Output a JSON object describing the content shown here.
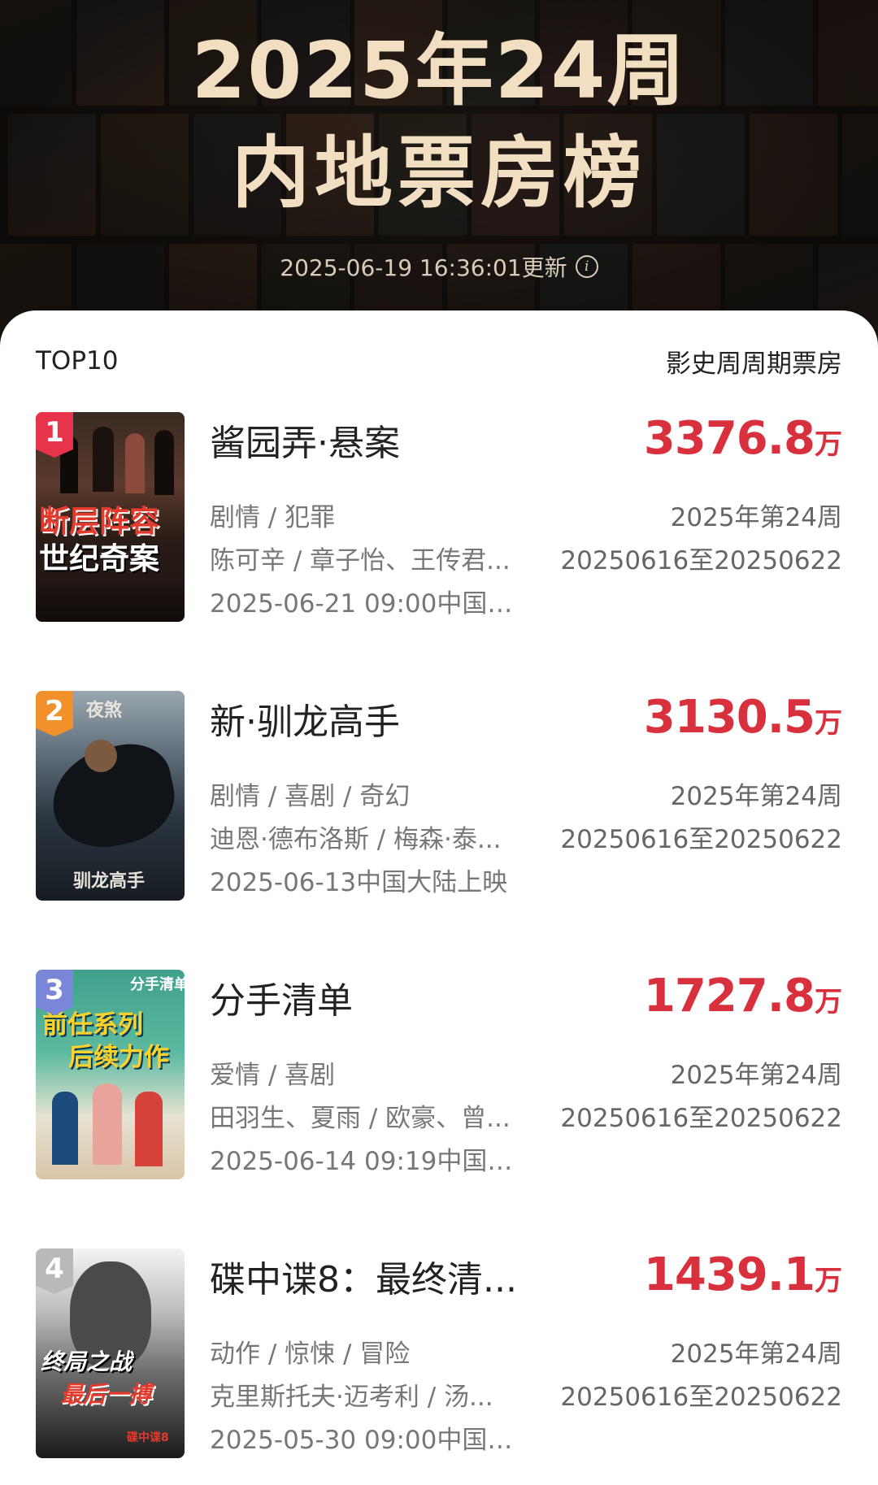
{
  "header": {
    "title_line1": "2025年24周",
    "title_line2": "内地票房榜",
    "updated": "2025-06-19 16:36:01更新",
    "info_icon": "info-icon"
  },
  "list": {
    "left_label": "TOP10",
    "right_label": "影史周周期票房"
  },
  "movies": [
    {
      "rank": "1",
      "rank_color": "#e8344a",
      "title": "酱园弄·悬案",
      "genres": "剧情 / 犯罪",
      "cast": "陈可辛 / 章子怡、王传君...",
      "release": "2025-06-21 09:00中国大...",
      "gross": "3376.8",
      "unit": "万",
      "week": "2025年第24周",
      "date_range": "20250616至20250622",
      "poster_text": [
        "断层阵容",
        "世纪奇案"
      ]
    },
    {
      "rank": "2",
      "rank_color": "#f2902c",
      "title": "新·驯龙高手",
      "genres": "剧情 / 喜剧 / 奇幻",
      "cast": "迪恩·德布洛斯 / 梅森·泰...",
      "release": "2025-06-13中国大陆上映",
      "gross": "3130.5",
      "unit": "万",
      "week": "2025年第24周",
      "date_range": "20250616至20250622",
      "poster_text": [
        "夜煞",
        "驯龙高手"
      ]
    },
    {
      "rank": "3",
      "rank_color": "#7a86d8",
      "title": "分手清单",
      "genres": "爱情 / 喜剧",
      "cast": "田羽生、夏雨 / 欧豪、曾...",
      "release": "2025-06-14 09:19中国大...",
      "gross": "1727.8",
      "unit": "万",
      "week": "2025年第24周",
      "date_range": "20250616至20250622",
      "poster_text": [
        "前任系列",
        "后续力作",
        "分手清单"
      ]
    },
    {
      "rank": "4",
      "rank_color": "#b9b9b9",
      "title": "碟中谍8：最终清...",
      "genres": "动作 / 惊悚 / 冒险",
      "cast": "克里斯托夫·迈考利 / 汤...",
      "release": "2025-05-30 09:00中国大...",
      "gross": "1439.1",
      "unit": "万",
      "week": "2025年第24周",
      "date_range": "20250616至20250622",
      "poster_text": [
        "终局之战",
        "最后一搏",
        "碟中谍8"
      ]
    }
  ]
}
